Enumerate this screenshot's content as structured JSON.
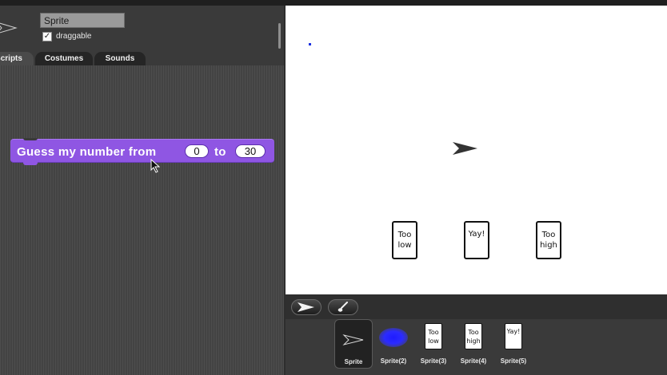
{
  "sprite_header": {
    "name_value": "Sprite",
    "draggable_label": "draggable",
    "draggable_checked": true,
    "checkbox_mark": "✓"
  },
  "tabs": [
    {
      "label": "Scripts",
      "active": true
    },
    {
      "label": "Costumes",
      "active": false
    },
    {
      "label": "Sounds",
      "active": false
    }
  ],
  "script_block": {
    "label_part1": "Guess my number from",
    "from_value": "0",
    "label_part2": "to",
    "to_value": "30",
    "color": "#8f56e3"
  },
  "stage": {
    "cards": [
      {
        "text": "Too low"
      },
      {
        "text": "Yay!"
      },
      {
        "text": "Too high"
      }
    ]
  },
  "stage_tools": {
    "turtle_icon": "turtle-arrow-icon",
    "paint_icon": "paintbrush-icon"
  },
  "corral": {
    "sprites": [
      {
        "label": "Sprite",
        "thumb": "arrow",
        "selected": true
      },
      {
        "label": "Sprite(2)",
        "thumb": "blue-blob",
        "selected": false
      },
      {
        "label": "Sprite(3)",
        "thumb": "card",
        "card_text": "Too low",
        "selected": false
      },
      {
        "label": "Sprite(4)",
        "thumb": "card",
        "card_text": "Too high",
        "selected": false
      },
      {
        "label": "Sprite(5)",
        "thumb": "card",
        "card_text": "Yay!",
        "selected": false
      }
    ]
  }
}
